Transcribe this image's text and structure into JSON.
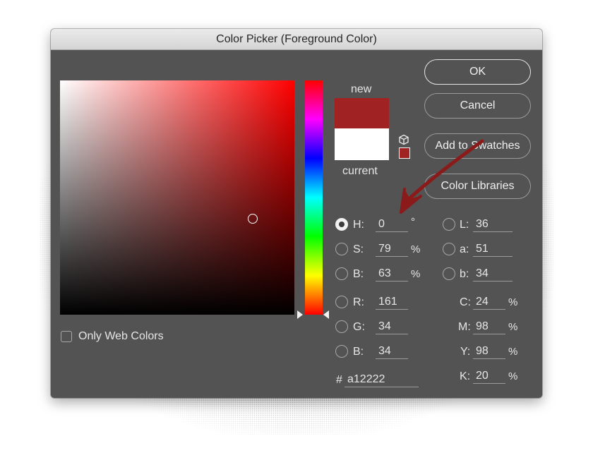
{
  "window": {
    "title": "Color Picker (Foreground Color)"
  },
  "preview": {
    "new_label": "new",
    "current_label": "current",
    "new_color": "#a12222",
    "current_color": "#ffffff"
  },
  "buttons": {
    "ok": "OK",
    "cancel": "Cancel",
    "add_swatches": "Add to Swatches",
    "color_libraries": "Color Libraries"
  },
  "web_colors": {
    "label": "Only Web Colors",
    "checked": false
  },
  "hsb": {
    "h": {
      "label": "H:",
      "value": "0",
      "unit": "°",
      "selected": true
    },
    "s": {
      "label": "S:",
      "value": "79",
      "unit": "%",
      "selected": false
    },
    "b": {
      "label": "B:",
      "value": "63",
      "unit": "%",
      "selected": false
    }
  },
  "rgb": {
    "r": {
      "label": "R:",
      "value": "161"
    },
    "g": {
      "label": "G:",
      "value": "34"
    },
    "b": {
      "label": "B:",
      "value": "34"
    }
  },
  "lab": {
    "l": {
      "label": "L:",
      "value": "36"
    },
    "a": {
      "label": "a:",
      "value": "51"
    },
    "b": {
      "label": "b:",
      "value": "34"
    }
  },
  "cmyk": {
    "c": {
      "label": "C:",
      "value": "24",
      "unit": "%"
    },
    "m": {
      "label": "M:",
      "value": "98",
      "unit": "%"
    },
    "y": {
      "label": "Y:",
      "value": "98",
      "unit": "%"
    },
    "k": {
      "label": "K:",
      "value": "20",
      "unit": "%"
    }
  },
  "hex": {
    "label": "#",
    "value": "a12222"
  },
  "icons": {
    "gamut_cube": "cube-icon",
    "websafe_swatch": "websafe-swatch-icon",
    "annotation": "annotation-arrow"
  }
}
